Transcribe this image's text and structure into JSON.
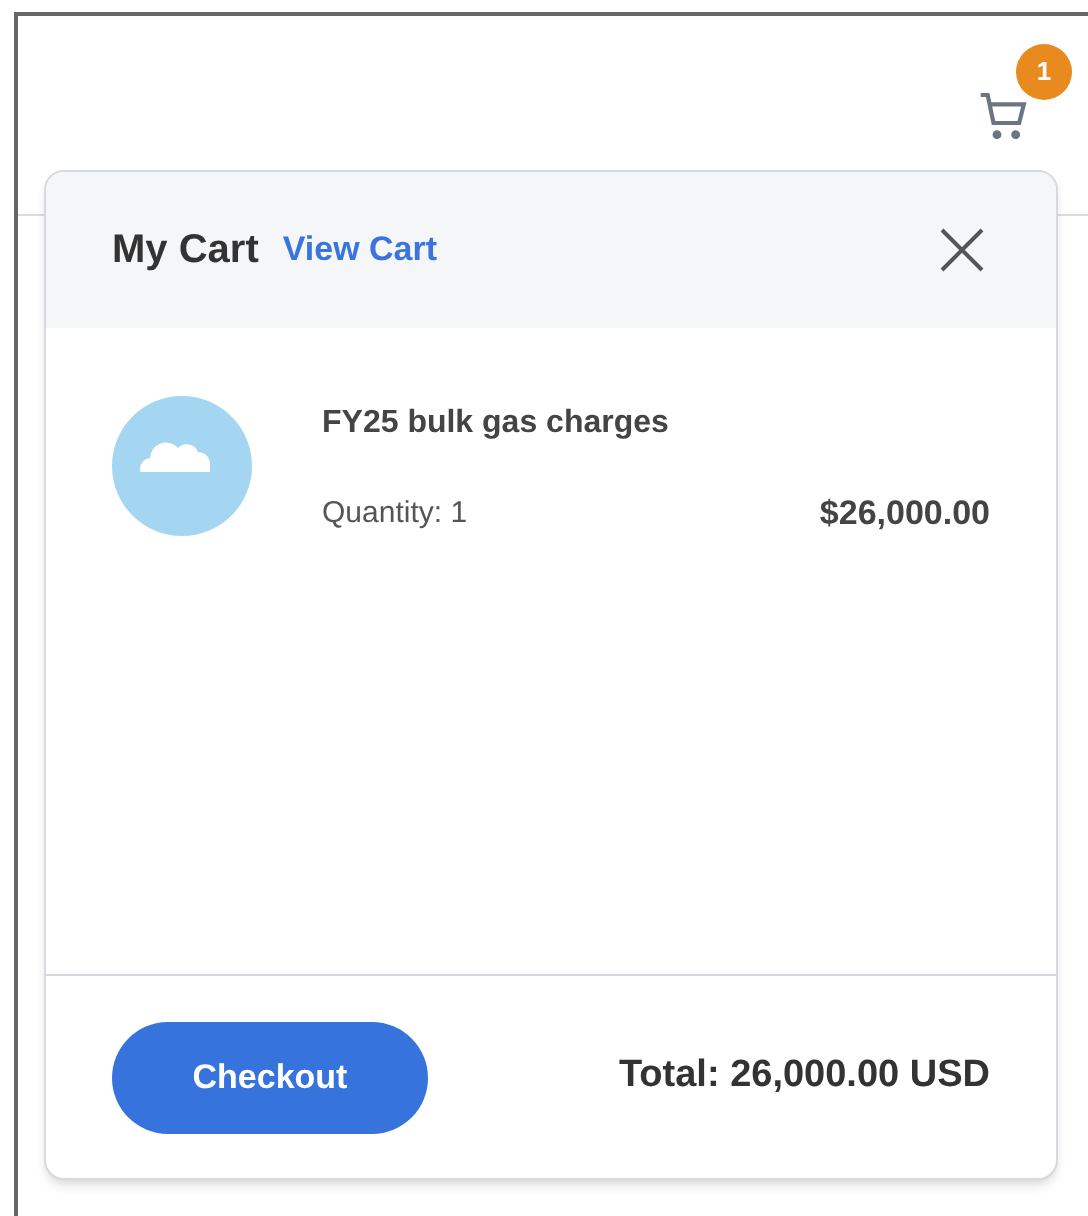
{
  "top_bar": {
    "cart_badge": "1"
  },
  "cart_popup": {
    "title": "My Cart",
    "view_cart_link": "View Cart",
    "items": [
      {
        "name": "FY25 bulk gas charges",
        "quantity": "Quantity: 1",
        "price": "$26,000.00"
      }
    ],
    "checkout_button": "Checkout",
    "total": "Total: 26,000.00 USD"
  }
}
